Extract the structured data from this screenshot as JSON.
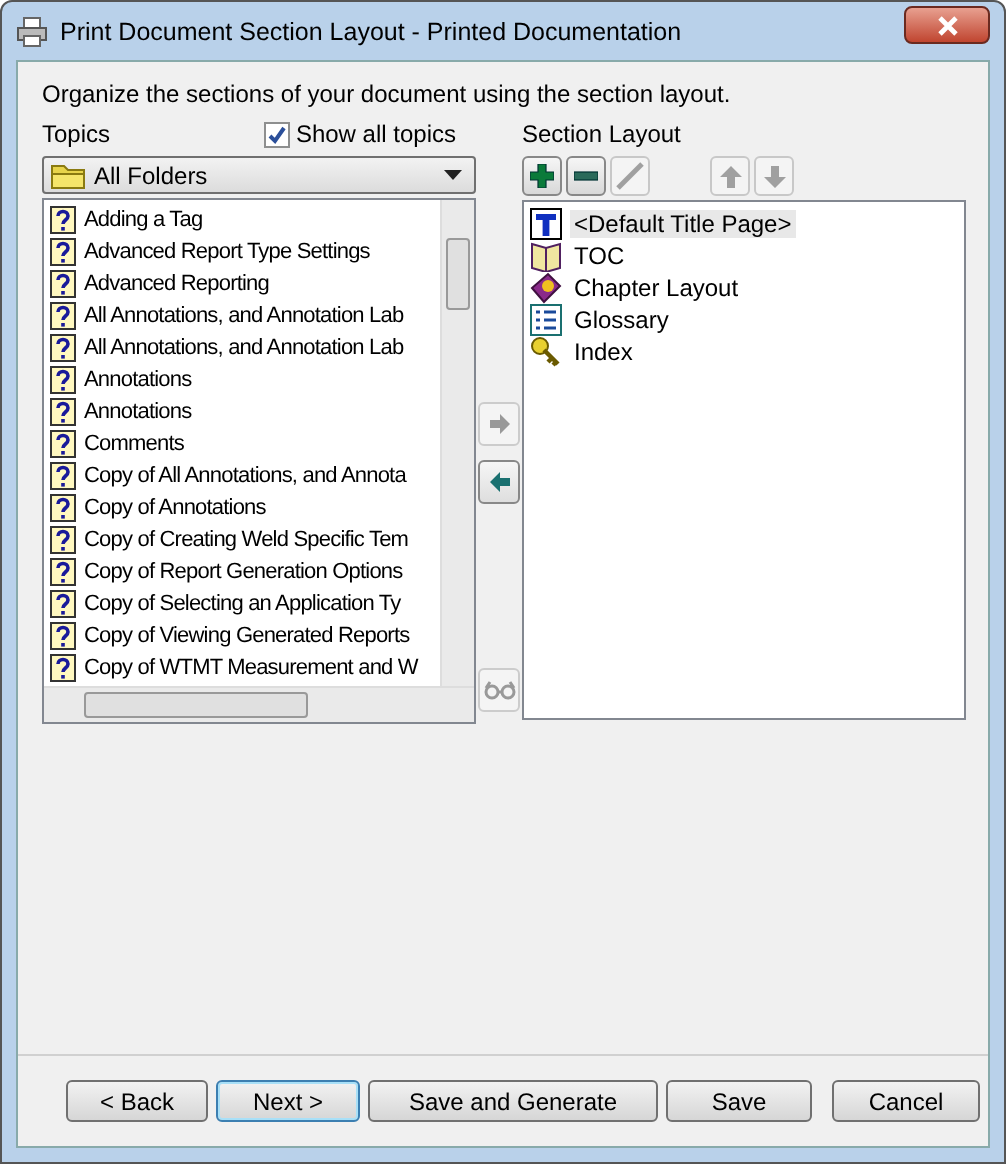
{
  "window": {
    "title": "Print Document Section Layout - Printed Documentation"
  },
  "instructions": "Organize the sections of your document using the section layout.",
  "topics": {
    "label": "Topics",
    "show_all": {
      "label": "Show all topics",
      "checked": true
    },
    "folder": "All Folders",
    "items": [
      "Adding a Tag",
      "Advanced Report Type Settings",
      "Advanced Reporting",
      "All Annotations, and Annotation Lab",
      "All Annotations, and Annotation Lab",
      "Annotations",
      "Annotations",
      "Comments",
      "Copy of All Annotations, and Annota",
      "Copy of Annotations",
      "Copy of Creating Weld Specific Tem",
      "Copy of Report Generation Options",
      "Copy of Selecting an Application Ty",
      "Copy of Viewing Generated Reports",
      "Copy of WTMT Measurement and W"
    ]
  },
  "transfer": {
    "add_disabled": true,
    "remove_disabled": false,
    "preview_disabled": true
  },
  "section_layout": {
    "label": "Section Layout",
    "toolbar": [
      {
        "kind": "add",
        "disabled": false
      },
      {
        "kind": "remove",
        "disabled": false
      },
      {
        "kind": "edit",
        "disabled": true
      },
      {
        "kind": "up",
        "disabled": true
      },
      {
        "kind": "down",
        "disabled": true
      }
    ],
    "items": [
      {
        "label": "<Default Title Page>",
        "kind": "title",
        "selected": true
      },
      {
        "label": "TOC",
        "kind": "toc",
        "selected": false
      },
      {
        "label": "Chapter Layout",
        "kind": "chapter",
        "selected": false
      },
      {
        "label": "Glossary",
        "kind": "glossary",
        "selected": false
      },
      {
        "label": "Index",
        "kind": "index",
        "selected": false
      }
    ]
  },
  "buttons": [
    {
      "label": "< Back",
      "default": false
    },
    {
      "label": "Next >",
      "default": true
    },
    {
      "label": "Save and Generate",
      "default": false
    },
    {
      "label": "Save",
      "default": false
    },
    {
      "label": "Cancel",
      "default": false
    }
  ]
}
